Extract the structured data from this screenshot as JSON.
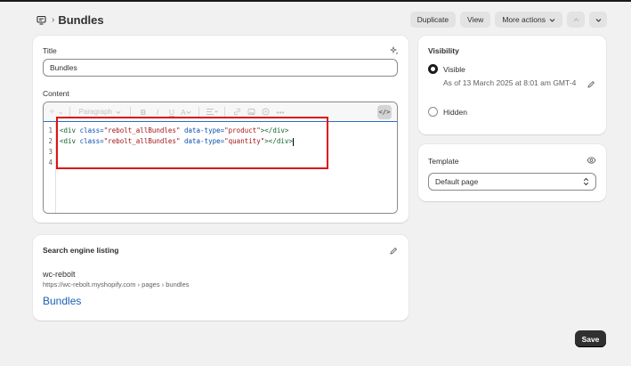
{
  "header": {
    "page_title": "Bundles",
    "duplicate_label": "Duplicate",
    "view_label": "View",
    "more_actions_label": "More actions"
  },
  "main": {
    "title_label": "Title",
    "title_value": "Bundles",
    "content_label": "Content",
    "toolbar": {
      "paragraph_label": "Paragraph",
      "bold": "B",
      "italic": "I",
      "underline": "U",
      "text_color": "A",
      "code_toggle": "</>"
    },
    "code": {
      "line_numbers": [
        "1",
        "2",
        "3",
        "4"
      ],
      "line1": {
        "open": "<div ",
        "attr1": "class=",
        "val1": "\"rebolt_allBundles\"",
        "attr2": " data-type=",
        "val2": "\"product\"",
        "close": "></div>"
      },
      "line2": {
        "open": "<div ",
        "attr1": "class=",
        "val1": "\"rebolt_allBundles\"",
        "attr2": " data-type=",
        "val2": "\"quantity\"",
        "close": "></div>"
      }
    }
  },
  "seo": {
    "heading": "Search engine listing",
    "store_name": "wc-rebolt",
    "url": "https://wc-rebolt.myshopify.com › pages › bundles",
    "page_title": "Bundles"
  },
  "visibility": {
    "heading": "Visibility",
    "visible_label": "Visible",
    "visible_date": "As of 13 March 2025 at 8:01 am GMT-4",
    "hidden_label": "Hidden"
  },
  "template": {
    "heading": "Template",
    "selected": "Default page"
  },
  "footer": {
    "save_label": "Save"
  },
  "colors": {
    "accent_link": "#1a5fb4",
    "highlight_box": "#e01313",
    "primary_button": "#303030"
  }
}
